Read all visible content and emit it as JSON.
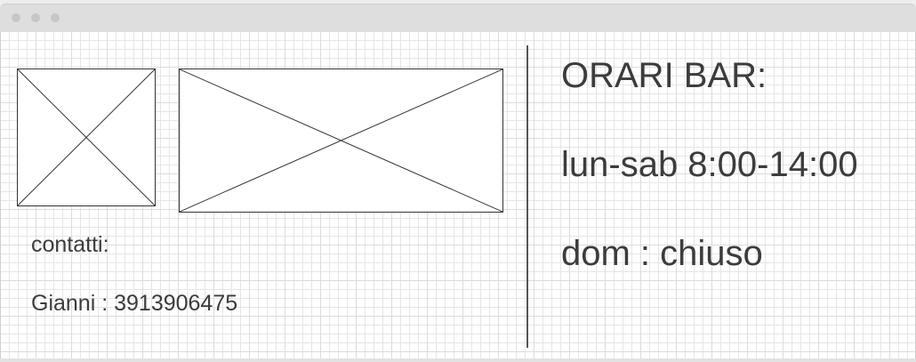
{
  "window": {
    "controls": [
      "window-dot",
      "window-dot",
      "window-dot"
    ]
  },
  "left_panel": {
    "contacts_label": "contatti:",
    "contact_entry": "Gianni : 3913906475",
    "image_placeholders": [
      "image-placeholder-icon",
      "image-placeholder-icon"
    ]
  },
  "right_panel": {
    "title": "ORARI BAR:",
    "hours_weekdays": "lun-sab 8:00-14:00",
    "hours_sunday": "dom : chiuso"
  },
  "colors": {
    "text": "#3c3c3c",
    "grid": "#e6e6e6",
    "titlebar": "#dedede",
    "divider": "#555555"
  }
}
